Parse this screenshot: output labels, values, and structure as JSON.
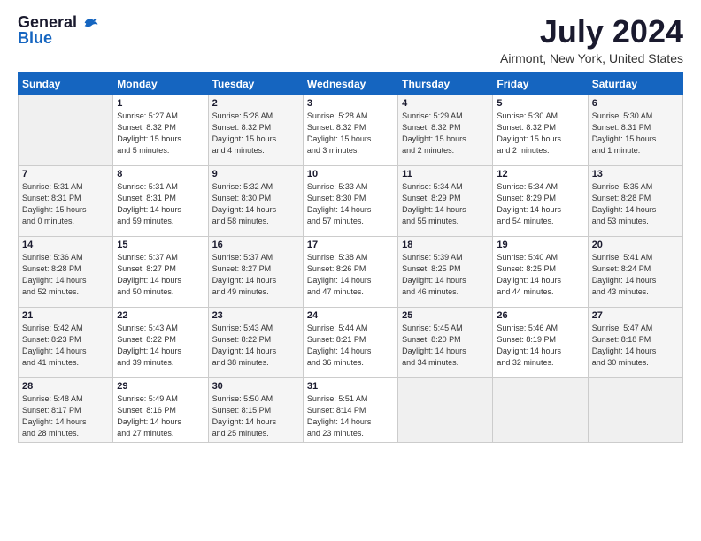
{
  "header": {
    "logo_general": "General",
    "logo_blue": "Blue",
    "title": "July 2024",
    "subtitle": "Airmont, New York, United States"
  },
  "days_of_week": [
    "Sunday",
    "Monday",
    "Tuesday",
    "Wednesday",
    "Thursday",
    "Friday",
    "Saturday"
  ],
  "weeks": [
    [
      {
        "day": "",
        "info": ""
      },
      {
        "day": "1",
        "info": "Sunrise: 5:27 AM\nSunset: 8:32 PM\nDaylight: 15 hours\nand 5 minutes."
      },
      {
        "day": "2",
        "info": "Sunrise: 5:28 AM\nSunset: 8:32 PM\nDaylight: 15 hours\nand 4 minutes."
      },
      {
        "day": "3",
        "info": "Sunrise: 5:28 AM\nSunset: 8:32 PM\nDaylight: 15 hours\nand 3 minutes."
      },
      {
        "day": "4",
        "info": "Sunrise: 5:29 AM\nSunset: 8:32 PM\nDaylight: 15 hours\nand 2 minutes."
      },
      {
        "day": "5",
        "info": "Sunrise: 5:30 AM\nSunset: 8:32 PM\nDaylight: 15 hours\nand 2 minutes."
      },
      {
        "day": "6",
        "info": "Sunrise: 5:30 AM\nSunset: 8:31 PM\nDaylight: 15 hours\nand 1 minute."
      }
    ],
    [
      {
        "day": "7",
        "info": "Sunrise: 5:31 AM\nSunset: 8:31 PM\nDaylight: 15 hours\nand 0 minutes."
      },
      {
        "day": "8",
        "info": "Sunrise: 5:31 AM\nSunset: 8:31 PM\nDaylight: 14 hours\nand 59 minutes."
      },
      {
        "day": "9",
        "info": "Sunrise: 5:32 AM\nSunset: 8:30 PM\nDaylight: 14 hours\nand 58 minutes."
      },
      {
        "day": "10",
        "info": "Sunrise: 5:33 AM\nSunset: 8:30 PM\nDaylight: 14 hours\nand 57 minutes."
      },
      {
        "day": "11",
        "info": "Sunrise: 5:34 AM\nSunset: 8:29 PM\nDaylight: 14 hours\nand 55 minutes."
      },
      {
        "day": "12",
        "info": "Sunrise: 5:34 AM\nSunset: 8:29 PM\nDaylight: 14 hours\nand 54 minutes."
      },
      {
        "day": "13",
        "info": "Sunrise: 5:35 AM\nSunset: 8:28 PM\nDaylight: 14 hours\nand 53 minutes."
      }
    ],
    [
      {
        "day": "14",
        "info": "Sunrise: 5:36 AM\nSunset: 8:28 PM\nDaylight: 14 hours\nand 52 minutes."
      },
      {
        "day": "15",
        "info": "Sunrise: 5:37 AM\nSunset: 8:27 PM\nDaylight: 14 hours\nand 50 minutes."
      },
      {
        "day": "16",
        "info": "Sunrise: 5:37 AM\nSunset: 8:27 PM\nDaylight: 14 hours\nand 49 minutes."
      },
      {
        "day": "17",
        "info": "Sunrise: 5:38 AM\nSunset: 8:26 PM\nDaylight: 14 hours\nand 47 minutes."
      },
      {
        "day": "18",
        "info": "Sunrise: 5:39 AM\nSunset: 8:25 PM\nDaylight: 14 hours\nand 46 minutes."
      },
      {
        "day": "19",
        "info": "Sunrise: 5:40 AM\nSunset: 8:25 PM\nDaylight: 14 hours\nand 44 minutes."
      },
      {
        "day": "20",
        "info": "Sunrise: 5:41 AM\nSunset: 8:24 PM\nDaylight: 14 hours\nand 43 minutes."
      }
    ],
    [
      {
        "day": "21",
        "info": "Sunrise: 5:42 AM\nSunset: 8:23 PM\nDaylight: 14 hours\nand 41 minutes."
      },
      {
        "day": "22",
        "info": "Sunrise: 5:43 AM\nSunset: 8:22 PM\nDaylight: 14 hours\nand 39 minutes."
      },
      {
        "day": "23",
        "info": "Sunrise: 5:43 AM\nSunset: 8:22 PM\nDaylight: 14 hours\nand 38 minutes."
      },
      {
        "day": "24",
        "info": "Sunrise: 5:44 AM\nSunset: 8:21 PM\nDaylight: 14 hours\nand 36 minutes."
      },
      {
        "day": "25",
        "info": "Sunrise: 5:45 AM\nSunset: 8:20 PM\nDaylight: 14 hours\nand 34 minutes."
      },
      {
        "day": "26",
        "info": "Sunrise: 5:46 AM\nSunset: 8:19 PM\nDaylight: 14 hours\nand 32 minutes."
      },
      {
        "day": "27",
        "info": "Sunrise: 5:47 AM\nSunset: 8:18 PM\nDaylight: 14 hours\nand 30 minutes."
      }
    ],
    [
      {
        "day": "28",
        "info": "Sunrise: 5:48 AM\nSunset: 8:17 PM\nDaylight: 14 hours\nand 28 minutes."
      },
      {
        "day": "29",
        "info": "Sunrise: 5:49 AM\nSunset: 8:16 PM\nDaylight: 14 hours\nand 27 minutes."
      },
      {
        "day": "30",
        "info": "Sunrise: 5:50 AM\nSunset: 8:15 PM\nDaylight: 14 hours\nand 25 minutes."
      },
      {
        "day": "31",
        "info": "Sunrise: 5:51 AM\nSunset: 8:14 PM\nDaylight: 14 hours\nand 23 minutes."
      },
      {
        "day": "",
        "info": ""
      },
      {
        "day": "",
        "info": ""
      },
      {
        "day": "",
        "info": ""
      }
    ]
  ]
}
